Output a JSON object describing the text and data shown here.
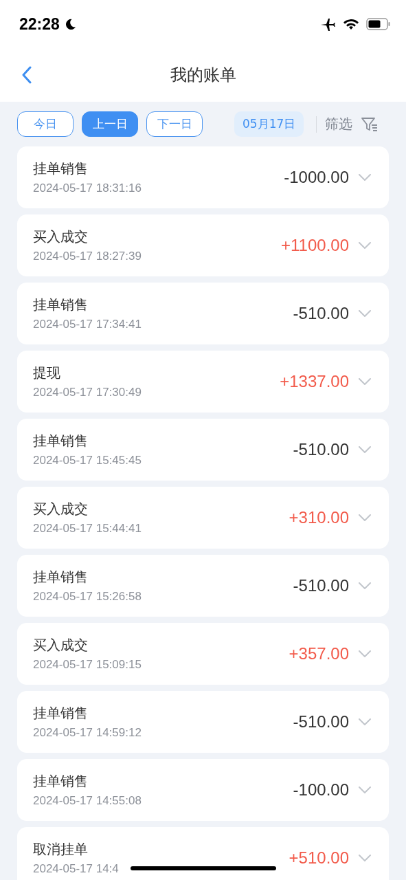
{
  "status_bar": {
    "time": "22:28"
  },
  "header": {
    "title": "我的账单"
  },
  "filters": {
    "days": [
      {
        "label": "今日",
        "selected": false
      },
      {
        "label": "上一日",
        "selected": true
      },
      {
        "label": "下一日",
        "selected": false
      }
    ],
    "date": "05月17日",
    "filter_label": "筛选"
  },
  "records": [
    {
      "title": "挂单销售",
      "time": "2024-05-17 18:31:16",
      "amount": "-1000.00",
      "income": false
    },
    {
      "title": "买入成交",
      "time": "2024-05-17 18:27:39",
      "amount": "+1100.00",
      "income": true
    },
    {
      "title": "挂单销售",
      "time": "2024-05-17 17:34:41",
      "amount": "-510.00",
      "income": false
    },
    {
      "title": "提现",
      "time": "2024-05-17 17:30:49",
      "amount": "+1337.00",
      "income": true
    },
    {
      "title": "挂单销售",
      "time": "2024-05-17 15:45:45",
      "amount": "-510.00",
      "income": false
    },
    {
      "title": "买入成交",
      "time": "2024-05-17 15:44:41",
      "amount": "+310.00",
      "income": true
    },
    {
      "title": "挂单销售",
      "time": "2024-05-17 15:26:58",
      "amount": "-510.00",
      "income": false
    },
    {
      "title": "买入成交",
      "time": "2024-05-17 15:09:15",
      "amount": "+357.00",
      "income": true
    },
    {
      "title": "挂单销售",
      "time": "2024-05-17 14:59:12",
      "amount": "-510.00",
      "income": false
    },
    {
      "title": "挂单销售",
      "time": "2024-05-17 14:55:08",
      "amount": "-100.00",
      "income": false
    },
    {
      "title": "取消挂单",
      "time": "2024-05-17 14:4",
      "amount": "+510.00",
      "income": true
    }
  ]
}
